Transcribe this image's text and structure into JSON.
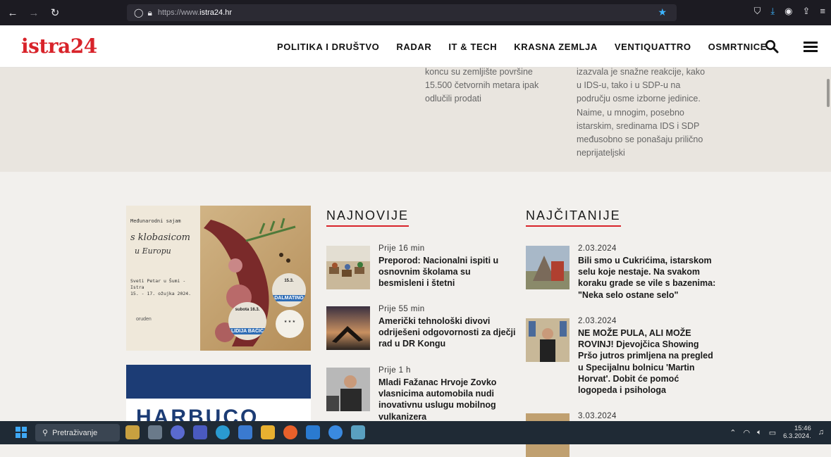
{
  "browser": {
    "url_prefix": "https://www.",
    "url_domain": "istra24.hr"
  },
  "site": {
    "logo": "istra24",
    "nav": [
      "POLITIKA I DRUŠTVO",
      "RADAR",
      "IT & TECH",
      "KRASNA ZEMLJA",
      "VENTIQUATTRO",
      "OSMRTNICE"
    ]
  },
  "teasers": [
    "koncu su zemljište površine 15.500 četvornih metara ipak odlučili prodati",
    "izazvala je snažne reakcije, kako u IDS-u, tako i u SDP-u na području osme izborne jedinice. Naime, u mnogim, posebno istarskim, sredinama IDS i SDP međusobno se ponašaju prilično neprijateljski"
  ],
  "ad": {
    "line1": "Međunarodni sajam",
    "line2": "s klobasicom",
    "line3": "u Europu",
    "line4": "Sveti Petar u Šumi - Istra",
    "line5": "15. - 17. ožujka 2024.",
    "badge1_day": "15.3.",
    "badge1_name": "DALMATINO",
    "badge2_day": "subota 16.3.",
    "badge2_name": "LIDIJA BAČIĆ",
    "logos_text": "oruden",
    "ad2_text": "HARBUCO"
  },
  "najnovije": {
    "title": "NAJNOVIJE",
    "items": [
      {
        "time": "Prije 16 min",
        "title": "Preporod: Nacionalni ispiti u osnovnim školama su besmisleni i štetni"
      },
      {
        "time": "Prije 55 min",
        "title": "Američki tehnološki divovi odriješeni odgovornosti za dječji rad u DR Kongu"
      },
      {
        "time": "Prije 1 h",
        "title": "Mladi Fažanac Hrvoje Zovko vlasnicima automobila nudi inovativnu uslugu mobilnog vulkanizera"
      }
    ]
  },
  "najcitanije": {
    "title": "NAJČITANIJE",
    "items": [
      {
        "time": "2.03.2024",
        "title": "Bili smo u Cukrićima, istarskom selu koje nestaje. Na svakom koraku grade se vile s bazenima: \"Neka selo ostane selo\""
      },
      {
        "time": "2.03.2024",
        "title": "NE MOŽE PULA, ALI MOŽE ROVINJ! Djevojčica Showing Pršo jutros primljena na pregled u Specijalnu bolnicu 'Martin Horvat'. Dobit će pomoć logopeda i psihologa"
      },
      {
        "time": "3.03.2024",
        "title": ""
      }
    ]
  },
  "taskbar": {
    "search_placeholder": "Pretraživanje",
    "time": "15:46",
    "date": "6.3.2024."
  },
  "colors": {
    "accent": "#d8232a",
    "taskbar": "#1f2a35",
    "browser": "#1c1b22"
  }
}
